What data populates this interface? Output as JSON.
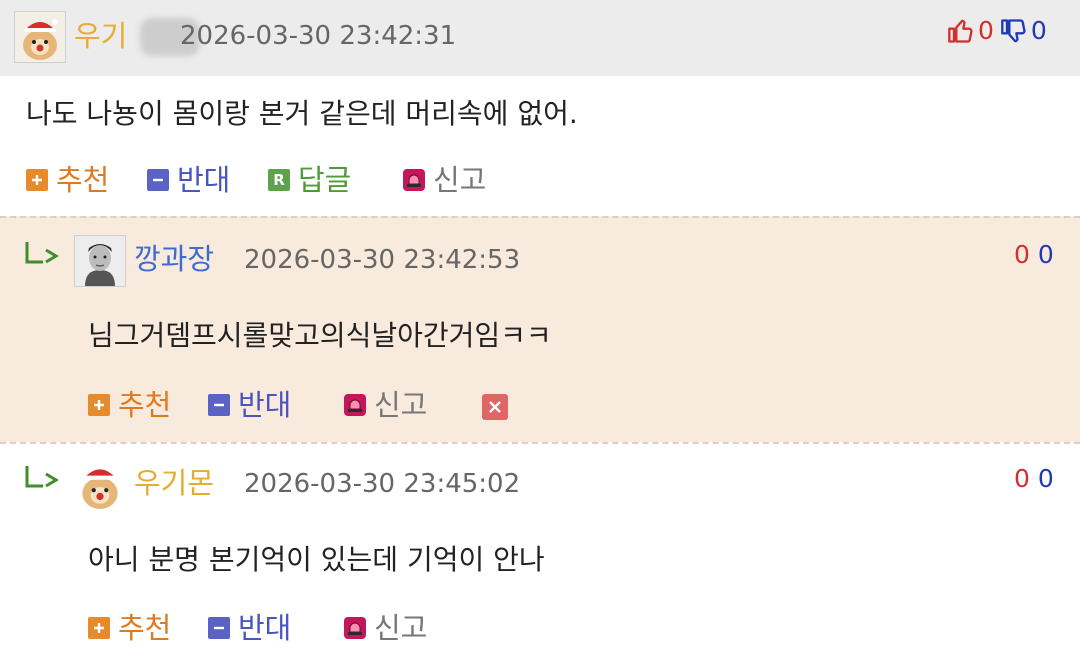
{
  "comments": [
    {
      "nick": "우기",
      "timestamp": "2026-03-30 23:42:31",
      "body": "나도 나뇽이 몸이랑 본거 같은데 머리속에 없어.",
      "upvotes": "0",
      "downvotes": "0",
      "actions": {
        "recommend": "추천",
        "oppose": "반대",
        "reply": "답글",
        "report": "신고"
      }
    },
    {
      "nick": "깡과장",
      "timestamp": "2026-03-30 23:42:53",
      "body": "님그거뎀프시롤맞고의식날아간거임ㅋㅋ",
      "upvotes": "0",
      "downvotes": "0",
      "actions": {
        "recommend": "추천",
        "oppose": "반대",
        "report": "신고"
      }
    },
    {
      "nick": "우기몬",
      "timestamp": "2026-03-30 23:45:02",
      "body": "아니 분명 본기억이 있는데 기억이 안나",
      "upvotes": "0",
      "downvotes": "0",
      "actions": {
        "recommend": "추천",
        "oppose": "반대",
        "report": "신고"
      }
    }
  ],
  "colors": {
    "header_bg": "#ececec",
    "reply_highlight_bg": "#f8eadc",
    "recommend": "#e07a1f",
    "oppose": "#4955c0",
    "reply": "#4f9a3a",
    "upvote": "#d32f2f",
    "downvote": "#1f3bb3"
  },
  "icons": [
    "avatar-dog-santa",
    "avatar-man",
    "thumbs-up-icon",
    "thumbs-down-icon",
    "plus-icon",
    "minus-icon",
    "reply-r-icon",
    "siren-icon",
    "reply-arrow-icon",
    "delete-x-icon"
  ]
}
